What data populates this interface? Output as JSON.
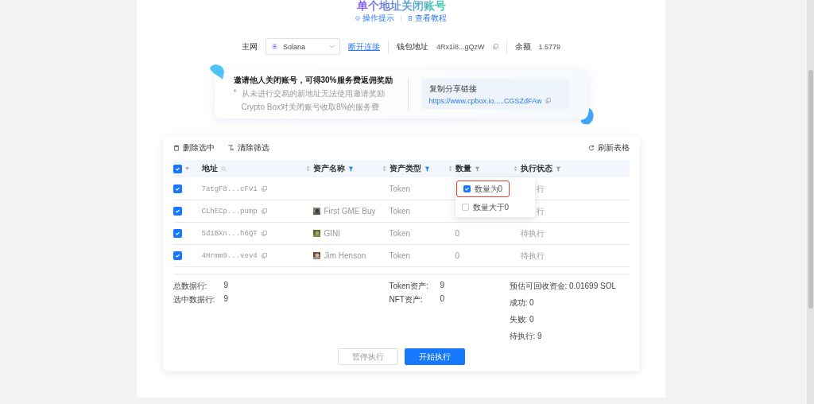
{
  "title": "单个地址关闭账号",
  "help_links": [
    {
      "kind": "info",
      "label": "操作提示"
    },
    {
      "kind": "doc",
      "label": "查看教程"
    }
  ],
  "connection": {
    "network_label": "主网",
    "network": "Solana",
    "disconnect": "断开连接",
    "wallet_label": "钱包地址",
    "wallet": "4Rx1i8...gQzW",
    "balance_label": "余额",
    "balance": "1.5779"
  },
  "invite": {
    "bullet": "*",
    "title": "邀请他人关闭账号，可得30%服务费返佣奖励",
    "notes": [
      "从未进行交易的新地址无法使用邀请奖励",
      "Crypto Box对关闭账号收取8%的服务费"
    ],
    "share_label": "复制分享链接",
    "share_link": "https://www.cpbox.io.....CGSZdFAw"
  },
  "toolbar": {
    "actions": [
      {
        "kind": "delete",
        "label": "删除选中"
      },
      {
        "kind": "clear",
        "label": "清除筛选"
      }
    ],
    "refresh": "刷新表格"
  },
  "table": {
    "select_all_checked": true,
    "columns": [
      {
        "kind": "search",
        "label": "地址"
      },
      {
        "kind": "sort",
        "label": "资产名称",
        "filter_active": true
      },
      {
        "kind": "sort",
        "label": "资产类型",
        "filter_active": true
      },
      {
        "kind": "sort",
        "label": "数量",
        "filter_active": false
      },
      {
        "kind": "sort",
        "label": "执行状态",
        "filter_active": false
      }
    ],
    "rows": [
      {
        "checked": true,
        "address": "7atgF8...cFv1",
        "asset_type": "Token",
        "status": "行",
        "status_covered": true
      },
      {
        "checked": true,
        "address": "CLhECp...pump",
        "asset_name": "First GME Buy",
        "asset_type": "Token",
        "status": "行",
        "status_covered": true
      },
      {
        "checked": true,
        "address": "5d1BXn...h6QT",
        "asset_name": "GINI",
        "asset_type": "Token",
        "quantity": "0",
        "status": "待执行",
        "status_covered": false
      },
      {
        "checked": true,
        "address": "4Hrmm9...vev4",
        "asset_name": "Jim Henson",
        "asset_type": "Token",
        "quantity": "0",
        "status": "待执行",
        "status_covered": false
      }
    ],
    "filter_menu": {
      "options": [
        {
          "label": "数量为0",
          "checked": true,
          "highlighted": true
        },
        {
          "label": "数量大于0",
          "checked": false,
          "highlighted": false
        }
      ]
    }
  },
  "summary": {
    "left": [
      {
        "label": "总数据行:",
        "value": "9"
      },
      {
        "label": "选中数据行:",
        "value": "9"
      }
    ],
    "middle": [
      {
        "label": "Token资产:",
        "value": "9"
      },
      {
        "label": "NFT资产:",
        "value": "0"
      }
    ],
    "right": [
      "预估可回收资金: 0.01699 SOL",
      "成功: 0",
      "失败: 0",
      "待执行: 9"
    ]
  },
  "buttons": [
    {
      "kind": "secondary",
      "label": "暂停执行",
      "disabled": true
    },
    {
      "kind": "primary",
      "label": "开始执行",
      "disabled": false
    }
  ]
}
